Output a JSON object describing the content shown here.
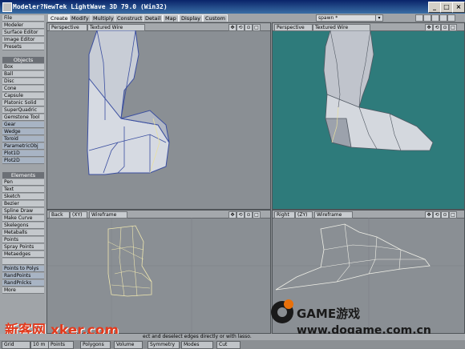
{
  "window": {
    "title": "Modeler?NewTek LightWave 3D 79.0 (Win32)"
  },
  "left_menu": [
    {
      "label": "File"
    },
    {
      "label": "Modeler"
    },
    {
      "label": "Surface Editor"
    },
    {
      "label": "Image Editor"
    },
    {
      "label": "Presets"
    }
  ],
  "tabs": [
    "Create",
    "Modify",
    "Multiply",
    "Construct",
    "Detail",
    "Map",
    "Display",
    "Custom"
  ],
  "layer_select": {
    "value": "spawn *"
  },
  "objects": {
    "header": "Objects",
    "items": [
      "Box",
      "Ball",
      "Disc",
      "Cone",
      "Capsule",
      "Platonic Solid",
      "SuperQuadric",
      "Gemstone Tool",
      "Gear",
      "Wedge",
      "Toroid",
      "ParametricObj",
      "Plot1D",
      "Plot2D"
    ]
  },
  "elements": {
    "header": "Elements",
    "items": [
      "Pen",
      "Text",
      "Sketch",
      "Bezier",
      "Spline Draw",
      "Make Curve",
      "Skelegons",
      "Metaballs",
      "Points",
      "Spray Points",
      "Metaedges",
      "",
      "Points to Polys",
      "RandPoints",
      "RandPnlcks",
      "More"
    ]
  },
  "viewports": [
    {
      "view": "Perspective",
      "mode": "Textured Wire"
    },
    {
      "view": "Perspective",
      "mode": "Textured Wire"
    },
    {
      "view": "Back",
      "axis": "(XY)",
      "mode": "Wireframe"
    },
    {
      "view": "Right",
      "axis": "(ZY)",
      "mode": "Wireframe"
    }
  ],
  "status": {
    "text": "ect and deselect edges directly or with lasso."
  },
  "bottombar": [
    "Grid",
    "10 m",
    "Points",
    "Polygons",
    "Volume",
    "Symmetry",
    "Modes",
    "Cut"
  ],
  "watermarks": {
    "left": "新客网 xker.com",
    "right_top": "GAME游戏",
    "right_bottom": "www.dogame.com.cn"
  },
  "colors": {
    "accent_teal": "#2e7b7b",
    "viewport_gray": "#8a8f94"
  }
}
